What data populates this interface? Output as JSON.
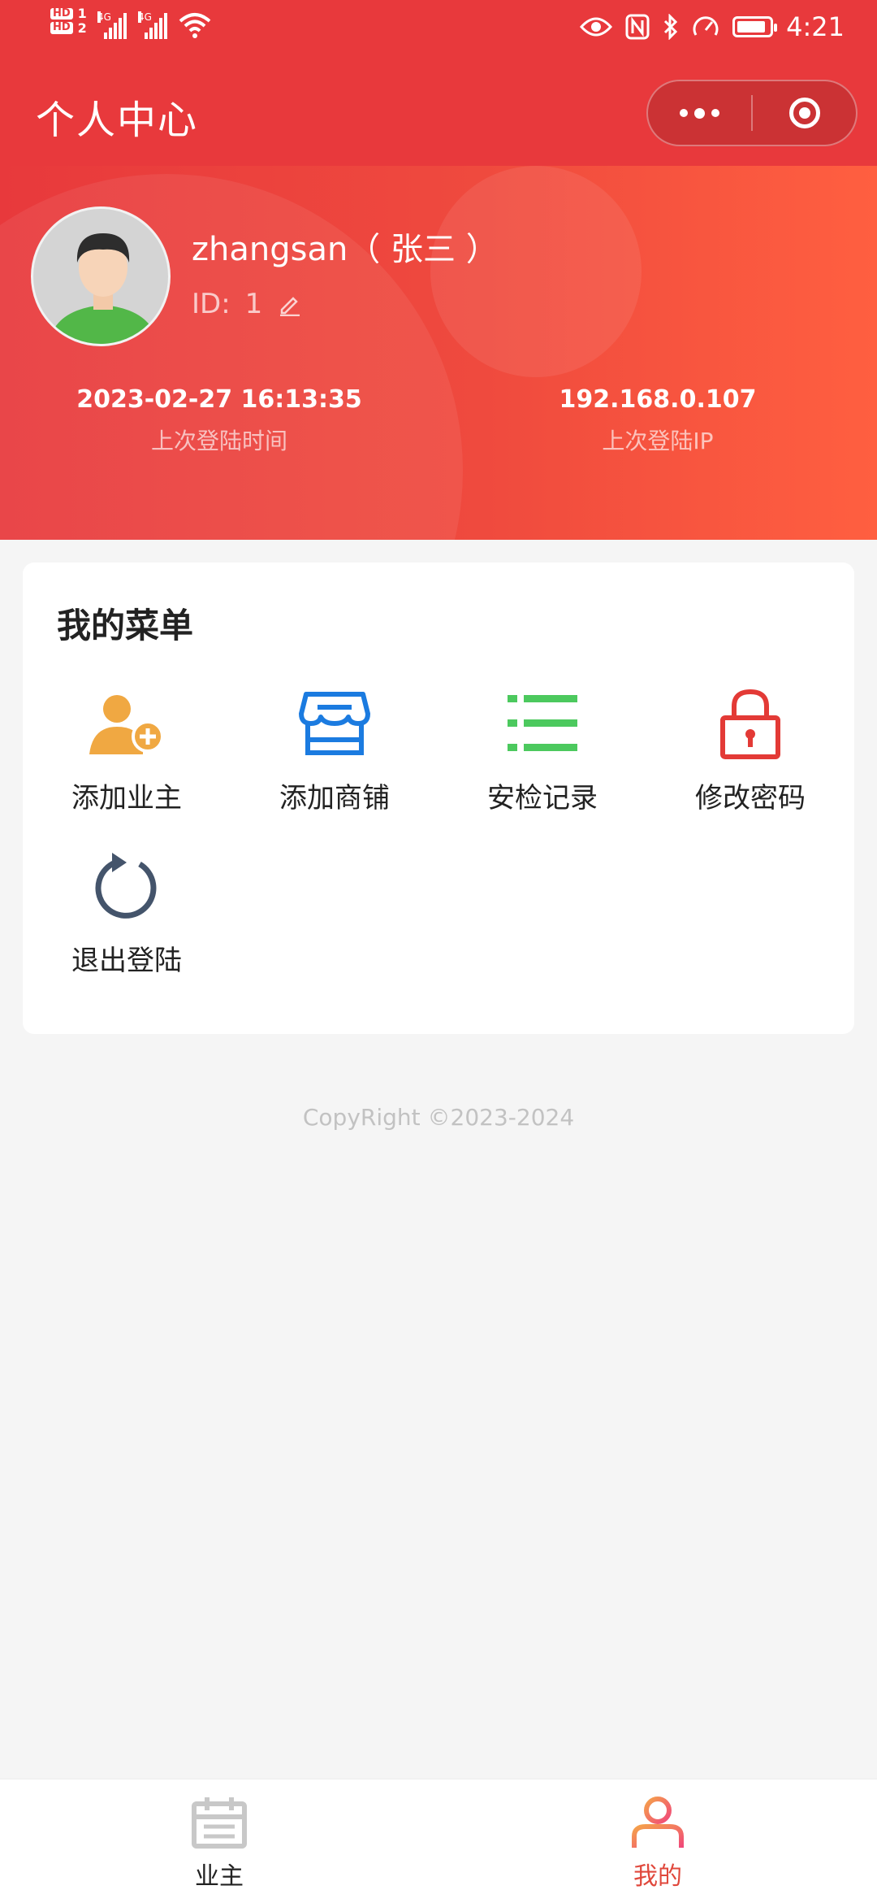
{
  "status_bar": {
    "hd1": "HD",
    "sim1": "1",
    "hd2": "HD",
    "sim2": "2",
    "net1": "4G",
    "net2": "4G",
    "time": "4:21",
    "battery_percent": 85
  },
  "header": {
    "title": "个人中心"
  },
  "profile": {
    "display_name": "zhangsan（ 张三 ）",
    "id_label": "ID:",
    "id_value": "1",
    "last_login_time": "2023-02-27 16:13:35",
    "last_login_time_label": "上次登陆时间",
    "last_login_ip": "192.168.0.107",
    "last_login_ip_label": "上次登陆IP"
  },
  "menu": {
    "title": "我的菜单",
    "items": [
      {
        "label": "添加业主",
        "icon": "add-user-icon",
        "color": "#f0a842"
      },
      {
        "label": "添加商铺",
        "icon": "store-icon",
        "color": "#1b7be0"
      },
      {
        "label": "安检记录",
        "icon": "list-icon",
        "color": "#4cc95e"
      },
      {
        "label": "修改密码",
        "icon": "lock-icon",
        "color": "#e33a36"
      },
      {
        "label": "退出登陆",
        "icon": "refresh-icon",
        "color": "#44546b"
      }
    ]
  },
  "footer": {
    "copyright": "CopyRight ©2023-2024"
  },
  "tab_bar": {
    "tabs": [
      {
        "label": "业主",
        "icon": "calendar-icon",
        "active": false
      },
      {
        "label": "我的",
        "icon": "user-icon",
        "active": true
      }
    ]
  },
  "colors": {
    "primary": "#e8393c",
    "gradient_end": "#ff5f40",
    "active_tab": "#e0483c",
    "inactive_tab": "#222222"
  }
}
